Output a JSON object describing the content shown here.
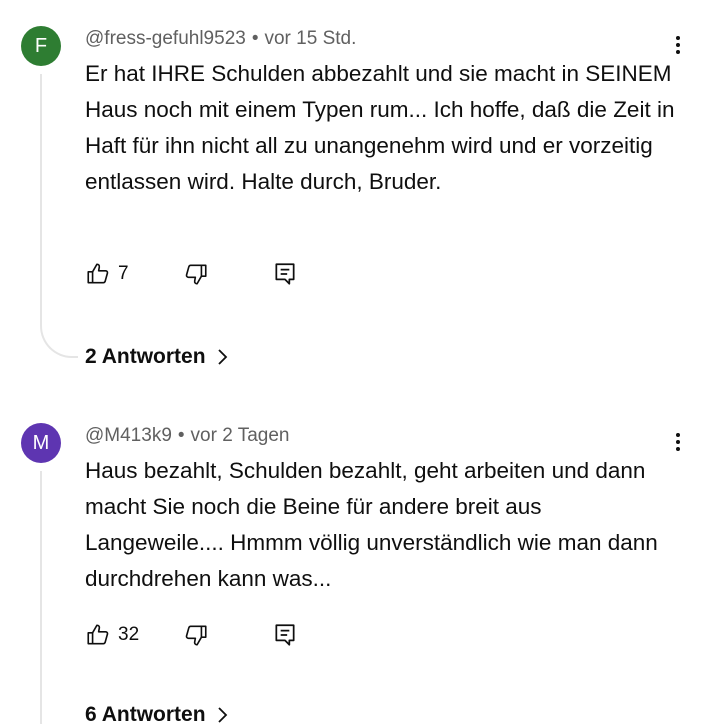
{
  "comments": [
    {
      "avatar_letter": "F",
      "avatar_color": "#2e7d32",
      "author": "@fress-gefuhl9523",
      "separator": "•",
      "time": "vor 15 Std.",
      "text": "Er hat IHRE Schulden abbezahlt und sie macht in SEINEM Haus noch mit einem Typen rum... Ich hoffe, daß die Zeit in Haft für ihn nicht all zu unangenehm wird und er vorzeitig entlassen wird. Halte durch, Bruder.",
      "likes": "7",
      "replies_label": "2 Antworten"
    },
    {
      "avatar_letter": "M",
      "avatar_color": "#5e35b1",
      "author": "@M413k9",
      "separator": "•",
      "time": "vor 2 Tagen",
      "text": "Haus bezahlt, Schulden bezahlt, geht arbeiten und dann macht Sie noch die Beine für andere breit aus Langeweile.... Hmmm völlig unverständlich wie man dann durchdrehen kann was...",
      "likes": "32",
      "replies_label": "6 Antworten"
    }
  ],
  "icons": {
    "like": "thumbs-up-icon",
    "dislike": "thumbs-down-icon",
    "reply": "comment-reply-icon",
    "more": "more-vertical-icon",
    "chevron": "chevron-right-icon"
  }
}
